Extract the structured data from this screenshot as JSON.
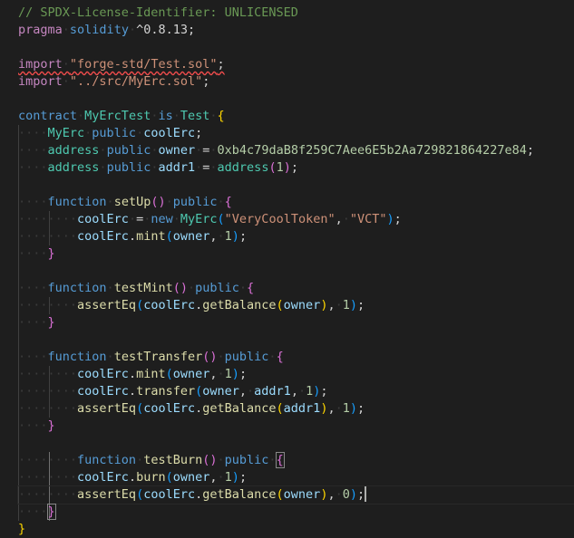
{
  "editor": {
    "language": "solidity",
    "lines": [
      [
        {
          "t": "// SPDX-License-Identifier: UNLICENSED",
          "c": "comment"
        }
      ],
      [
        {
          "t": "pragma",
          "c": "control"
        },
        {
          "t": "·",
          "c": "ws"
        },
        {
          "t": "solidity",
          "c": "keyword"
        },
        {
          "t": "·",
          "c": "ws"
        },
        {
          "t": "^0.8.13",
          "c": "plain"
        },
        {
          "t": ";",
          "c": "plain"
        }
      ],
      [],
      [
        {
          "t": "import",
          "c": "control",
          "sq": true
        },
        {
          "t": "·",
          "c": "ws",
          "sq": true
        },
        {
          "t": "\"forge-std/Test.sol\"",
          "c": "string",
          "sq": true
        },
        {
          "t": ";",
          "c": "plain",
          "sq": true
        }
      ],
      [
        {
          "t": "import",
          "c": "control"
        },
        {
          "t": "·",
          "c": "ws"
        },
        {
          "t": "\"../src/MyErc.sol\"",
          "c": "string"
        },
        {
          "t": ";",
          "c": "plain"
        }
      ],
      [],
      [
        {
          "t": "contract",
          "c": "keyword"
        },
        {
          "t": "·",
          "c": "ws"
        },
        {
          "t": "MyErcTest",
          "c": "type"
        },
        {
          "t": "·",
          "c": "ws"
        },
        {
          "t": "is",
          "c": "keyword"
        },
        {
          "t": "·",
          "c": "ws"
        },
        {
          "t": "Test",
          "c": "type"
        },
        {
          "t": "·",
          "c": "ws"
        },
        {
          "t": "{",
          "c": "br1"
        }
      ],
      [
        {
          "t": "····",
          "c": "ws"
        },
        {
          "t": "MyErc",
          "c": "type"
        },
        {
          "t": "·",
          "c": "ws"
        },
        {
          "t": "public",
          "c": "keyword"
        },
        {
          "t": "·",
          "c": "ws"
        },
        {
          "t": "coolErc",
          "c": "var"
        },
        {
          "t": ";",
          "c": "plain"
        }
      ],
      [
        {
          "t": "····",
          "c": "ws"
        },
        {
          "t": "address",
          "c": "type"
        },
        {
          "t": "·",
          "c": "ws"
        },
        {
          "t": "public",
          "c": "keyword"
        },
        {
          "t": "·",
          "c": "ws"
        },
        {
          "t": "owner",
          "c": "var"
        },
        {
          "t": "·",
          "c": "ws"
        },
        {
          "t": "=",
          "c": "plain"
        },
        {
          "t": "·",
          "c": "ws"
        },
        {
          "t": "0xb4c79daB8f259C7Aee6E5b2Aa729821864227e84",
          "c": "number"
        },
        {
          "t": ";",
          "c": "plain"
        }
      ],
      [
        {
          "t": "····",
          "c": "ws"
        },
        {
          "t": "address",
          "c": "type"
        },
        {
          "t": "·",
          "c": "ws"
        },
        {
          "t": "public",
          "c": "keyword"
        },
        {
          "t": "·",
          "c": "ws"
        },
        {
          "t": "addr1",
          "c": "var"
        },
        {
          "t": "·",
          "c": "ws"
        },
        {
          "t": "=",
          "c": "plain"
        },
        {
          "t": "·",
          "c": "ws"
        },
        {
          "t": "address",
          "c": "type"
        },
        {
          "t": "(",
          "c": "br2"
        },
        {
          "t": "1",
          "c": "number"
        },
        {
          "t": ")",
          "c": "br2"
        },
        {
          "t": ";",
          "c": "plain"
        }
      ],
      [],
      [
        {
          "t": "····",
          "c": "ws"
        },
        {
          "t": "function",
          "c": "keyword"
        },
        {
          "t": "·",
          "c": "ws"
        },
        {
          "t": "setUp",
          "c": "func"
        },
        {
          "t": "()",
          "c": "br2"
        },
        {
          "t": "·",
          "c": "ws"
        },
        {
          "t": "public",
          "c": "keyword"
        },
        {
          "t": "·",
          "c": "ws"
        },
        {
          "t": "{",
          "c": "br2"
        }
      ],
      [
        {
          "t": "········",
          "c": "ws"
        },
        {
          "t": "coolErc",
          "c": "var"
        },
        {
          "t": "·",
          "c": "ws"
        },
        {
          "t": "=",
          "c": "plain"
        },
        {
          "t": "·",
          "c": "ws"
        },
        {
          "t": "new",
          "c": "keyword"
        },
        {
          "t": "·",
          "c": "ws"
        },
        {
          "t": "MyErc",
          "c": "type"
        },
        {
          "t": "(",
          "c": "br3"
        },
        {
          "t": "\"VeryCoolToken\"",
          "c": "string"
        },
        {
          "t": ",",
          "c": "plain"
        },
        {
          "t": "·",
          "c": "ws"
        },
        {
          "t": "\"VCT\"",
          "c": "string"
        },
        {
          "t": ")",
          "c": "br3"
        },
        {
          "t": ";",
          "c": "plain"
        }
      ],
      [
        {
          "t": "········",
          "c": "ws"
        },
        {
          "t": "coolErc",
          "c": "var"
        },
        {
          "t": ".",
          "c": "plain"
        },
        {
          "t": "mint",
          "c": "func"
        },
        {
          "t": "(",
          "c": "br3"
        },
        {
          "t": "owner",
          "c": "var"
        },
        {
          "t": ",",
          "c": "plain"
        },
        {
          "t": "·",
          "c": "ws"
        },
        {
          "t": "1",
          "c": "number"
        },
        {
          "t": ")",
          "c": "br3"
        },
        {
          "t": ";",
          "c": "plain"
        }
      ],
      [
        {
          "t": "····",
          "c": "ws"
        },
        {
          "t": "}",
          "c": "br2"
        }
      ],
      [],
      [
        {
          "t": "····",
          "c": "ws"
        },
        {
          "t": "function",
          "c": "keyword"
        },
        {
          "t": "·",
          "c": "ws"
        },
        {
          "t": "testMint",
          "c": "func"
        },
        {
          "t": "()",
          "c": "br2"
        },
        {
          "t": "·",
          "c": "ws"
        },
        {
          "t": "public",
          "c": "keyword"
        },
        {
          "t": "·",
          "c": "ws"
        },
        {
          "t": "{",
          "c": "br2"
        }
      ],
      [
        {
          "t": "········",
          "c": "ws"
        },
        {
          "t": "assertEq",
          "c": "func"
        },
        {
          "t": "(",
          "c": "br3"
        },
        {
          "t": "coolErc",
          "c": "var"
        },
        {
          "t": ".",
          "c": "plain"
        },
        {
          "t": "getBalance",
          "c": "func"
        },
        {
          "t": "(",
          "c": "br1"
        },
        {
          "t": "owner",
          "c": "var"
        },
        {
          "t": ")",
          "c": "br1"
        },
        {
          "t": ",",
          "c": "plain"
        },
        {
          "t": "·",
          "c": "ws"
        },
        {
          "t": "1",
          "c": "number"
        },
        {
          "t": ")",
          "c": "br3"
        },
        {
          "t": ";",
          "c": "plain"
        }
      ],
      [
        {
          "t": "····",
          "c": "ws"
        },
        {
          "t": "}",
          "c": "br2"
        }
      ],
      [],
      [
        {
          "t": "····",
          "c": "ws"
        },
        {
          "t": "function",
          "c": "keyword"
        },
        {
          "t": "·",
          "c": "ws"
        },
        {
          "t": "testTransfer",
          "c": "func"
        },
        {
          "t": "()",
          "c": "br2"
        },
        {
          "t": "·",
          "c": "ws"
        },
        {
          "t": "public",
          "c": "keyword"
        },
        {
          "t": "·",
          "c": "ws"
        },
        {
          "t": "{",
          "c": "br2"
        }
      ],
      [
        {
          "t": "········",
          "c": "ws"
        },
        {
          "t": "coolErc",
          "c": "var"
        },
        {
          "t": ".",
          "c": "plain"
        },
        {
          "t": "mint",
          "c": "func"
        },
        {
          "t": "(",
          "c": "br3"
        },
        {
          "t": "owner",
          "c": "var"
        },
        {
          "t": ",",
          "c": "plain"
        },
        {
          "t": "·",
          "c": "ws"
        },
        {
          "t": "1",
          "c": "number"
        },
        {
          "t": ")",
          "c": "br3"
        },
        {
          "t": ";",
          "c": "plain"
        }
      ],
      [
        {
          "t": "········",
          "c": "ws"
        },
        {
          "t": "coolErc",
          "c": "var"
        },
        {
          "t": ".",
          "c": "plain"
        },
        {
          "t": "transfer",
          "c": "func"
        },
        {
          "t": "(",
          "c": "br3"
        },
        {
          "t": "owner",
          "c": "var"
        },
        {
          "t": ",",
          "c": "plain"
        },
        {
          "t": "·",
          "c": "ws"
        },
        {
          "t": "addr1",
          "c": "var"
        },
        {
          "t": ",",
          "c": "plain"
        },
        {
          "t": "·",
          "c": "ws"
        },
        {
          "t": "1",
          "c": "number"
        },
        {
          "t": ")",
          "c": "br3"
        },
        {
          "t": ";",
          "c": "plain"
        }
      ],
      [
        {
          "t": "········",
          "c": "ws"
        },
        {
          "t": "assertEq",
          "c": "func"
        },
        {
          "t": "(",
          "c": "br3"
        },
        {
          "t": "coolErc",
          "c": "var"
        },
        {
          "t": ".",
          "c": "plain"
        },
        {
          "t": "getBalance",
          "c": "func"
        },
        {
          "t": "(",
          "c": "br1"
        },
        {
          "t": "addr1",
          "c": "var"
        },
        {
          "t": ")",
          "c": "br1"
        },
        {
          "t": ",",
          "c": "plain"
        },
        {
          "t": "·",
          "c": "ws"
        },
        {
          "t": "1",
          "c": "number"
        },
        {
          "t": ")",
          "c": "br3"
        },
        {
          "t": ";",
          "c": "plain"
        }
      ],
      [
        {
          "t": "····",
          "c": "ws"
        },
        {
          "t": "}",
          "c": "br2"
        }
      ],
      [],
      [
        {
          "t": "········",
          "c": "ws"
        },
        {
          "t": "function",
          "c": "keyword"
        },
        {
          "t": "·",
          "c": "ws"
        },
        {
          "t": "testBurn",
          "c": "func"
        },
        {
          "t": "()",
          "c": "br2"
        },
        {
          "t": "·",
          "c": "ws"
        },
        {
          "t": "public",
          "c": "keyword"
        },
        {
          "t": "·",
          "c": "ws"
        },
        {
          "t": "{",
          "c": "br2",
          "box": true
        }
      ],
      [
        {
          "t": "········",
          "c": "ws"
        },
        {
          "t": "coolErc",
          "c": "var"
        },
        {
          "t": ".",
          "c": "plain"
        },
        {
          "t": "burn",
          "c": "func"
        },
        {
          "t": "(",
          "c": "br3"
        },
        {
          "t": "owner",
          "c": "var"
        },
        {
          "t": ",",
          "c": "plain"
        },
        {
          "t": "·",
          "c": "ws"
        },
        {
          "t": "1",
          "c": "number"
        },
        {
          "t": ")",
          "c": "br3"
        },
        {
          "t": ";",
          "c": "plain"
        }
      ],
      [
        {
          "t": "········",
          "c": "ws"
        },
        {
          "t": "assertEq",
          "c": "func"
        },
        {
          "t": "(",
          "c": "br3"
        },
        {
          "t": "coolErc",
          "c": "var"
        },
        {
          "t": ".",
          "c": "plain"
        },
        {
          "t": "getBalance",
          "c": "func"
        },
        {
          "t": "(",
          "c": "br1"
        },
        {
          "t": "owner",
          "c": "var"
        },
        {
          "t": ")",
          "c": "br1"
        },
        {
          "t": ",",
          "c": "plain"
        },
        {
          "t": "·",
          "c": "ws"
        },
        {
          "t": "0",
          "c": "number"
        },
        {
          "t": ")",
          "c": "br3"
        },
        {
          "t": ";",
          "c": "plain",
          "cursor": true
        }
      ],
      [
        {
          "t": "····",
          "c": "ws"
        },
        {
          "t": "}",
          "c": "br2",
          "box": true
        }
      ],
      [
        {
          "t": "}",
          "c": "br1"
        }
      ]
    ],
    "active_line": 28,
    "colors": {
      "background": "#1e1e1e",
      "comment": "#6a9955",
      "keyword": "#569cd6",
      "control": "#c586c0",
      "type": "#4ec9b0",
      "function": "#dcdcaa",
      "string": "#ce9178",
      "number": "#b5cea8",
      "variable": "#9cdcfe",
      "error_squiggle": "#f14c4c"
    }
  }
}
